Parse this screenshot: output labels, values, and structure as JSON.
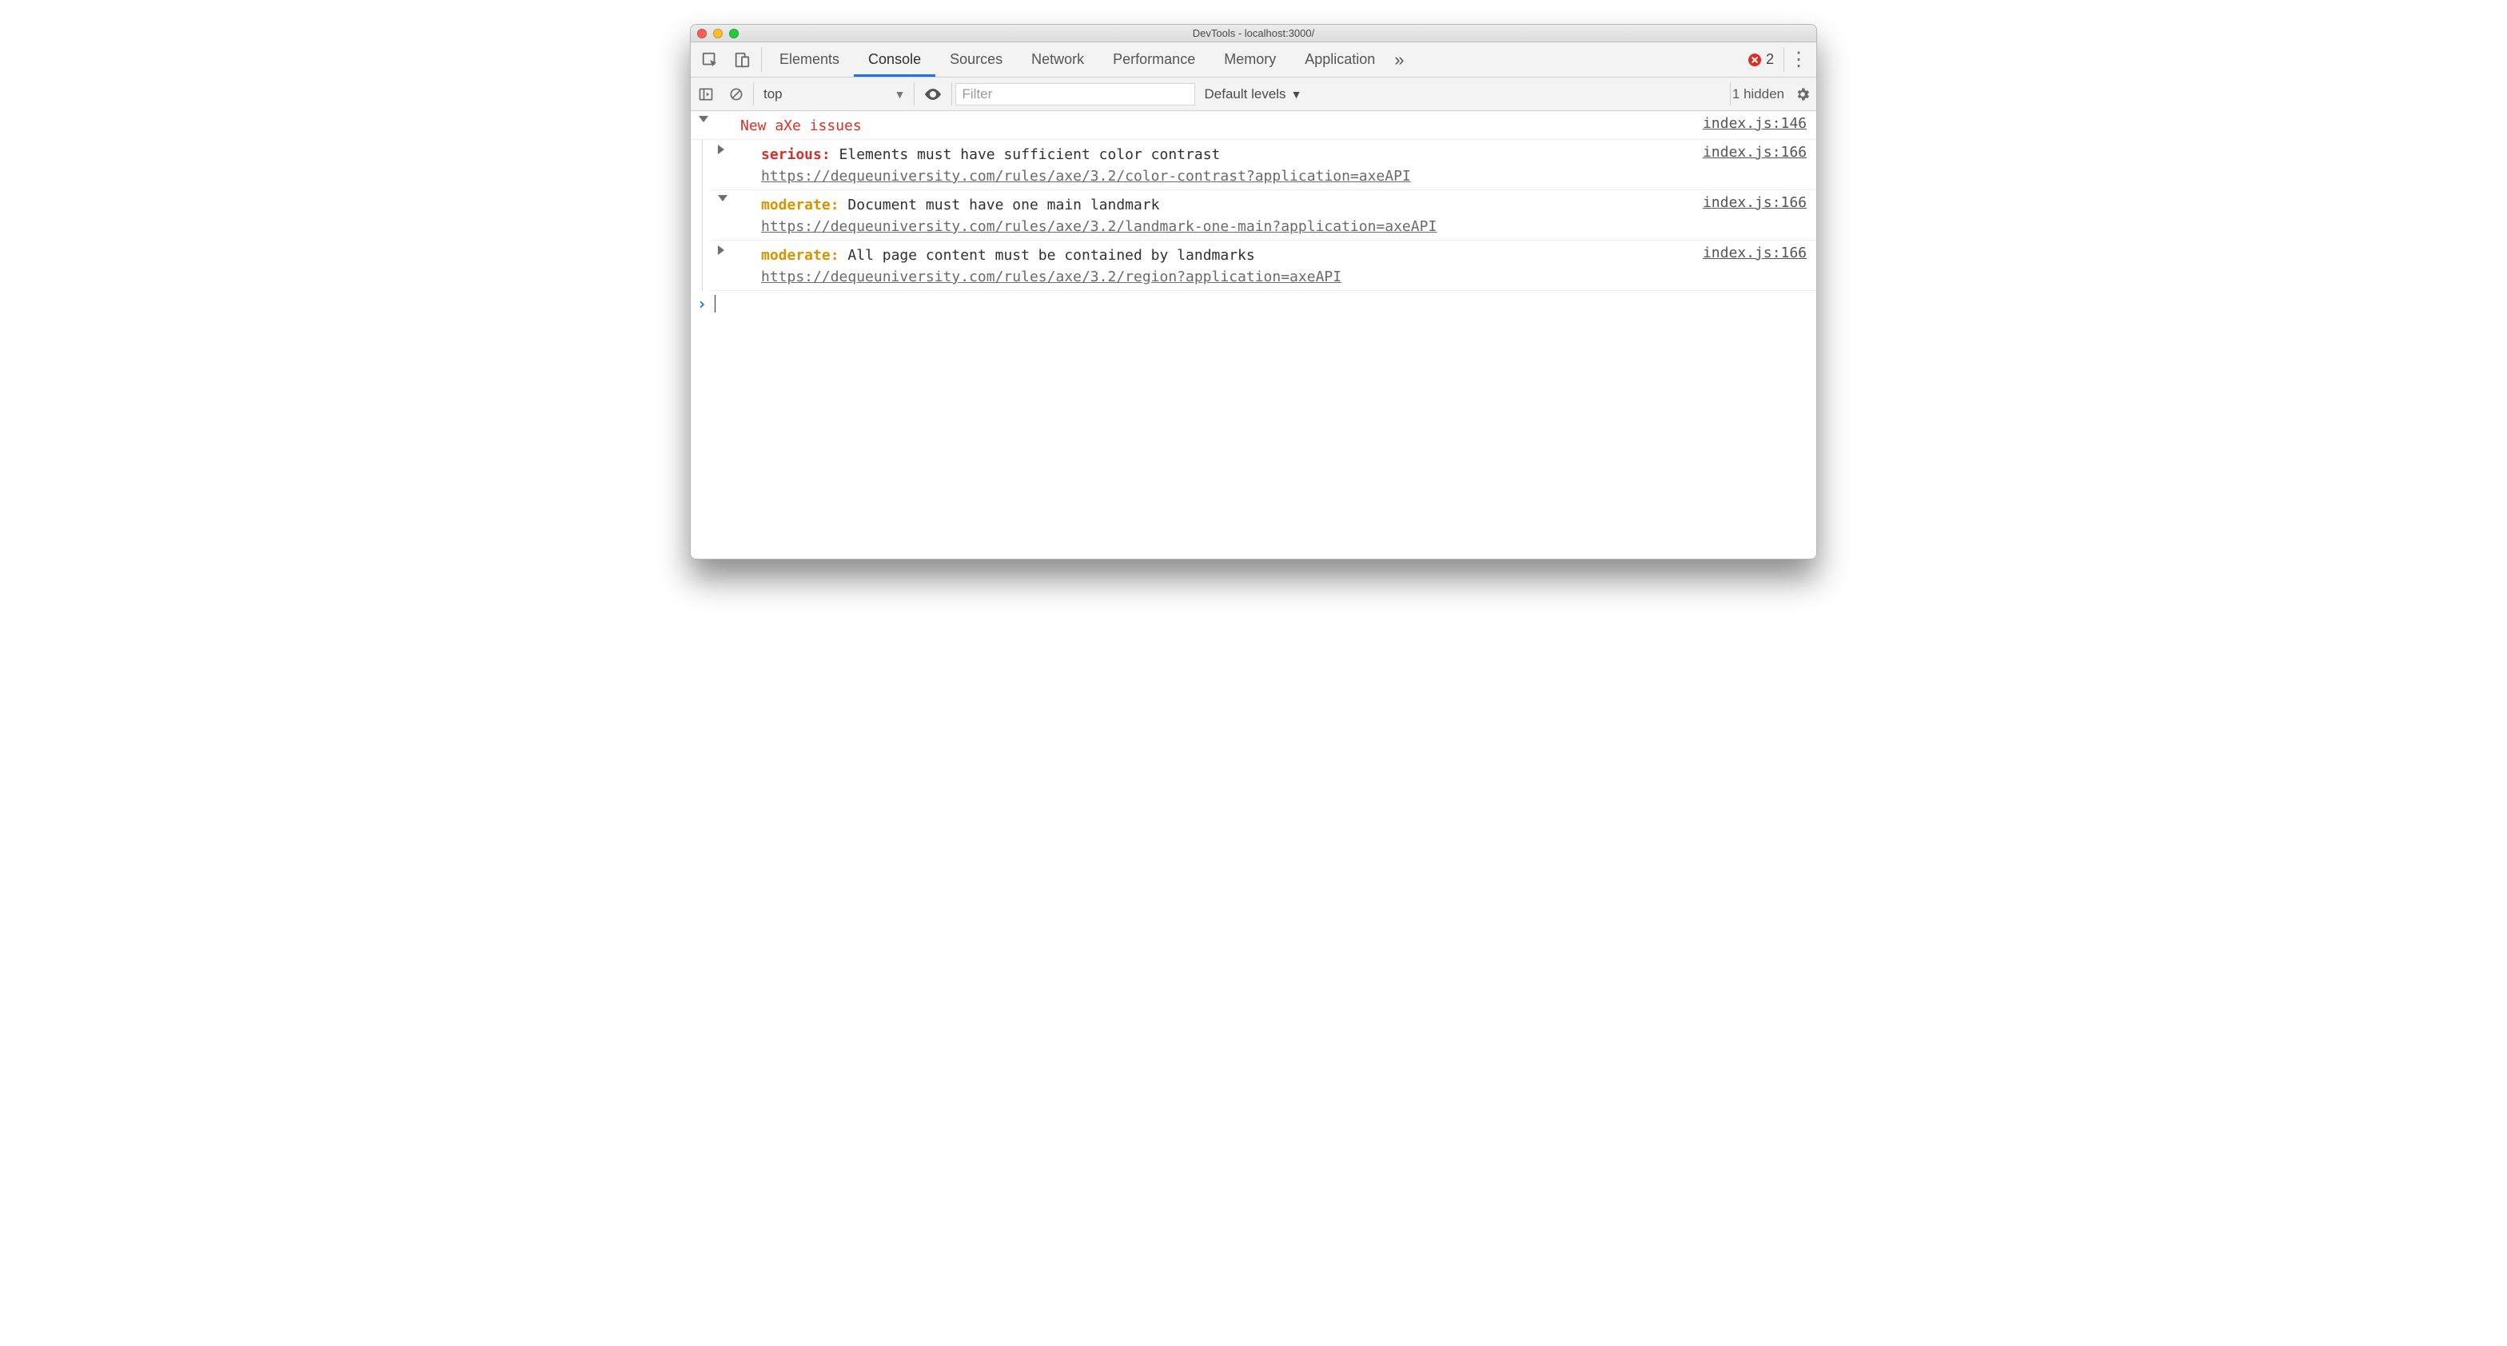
{
  "window": {
    "title": "DevTools - localhost:3000/"
  },
  "tabs": {
    "items": [
      "Elements",
      "Console",
      "Sources",
      "Network",
      "Performance",
      "Memory",
      "Application"
    ],
    "selected_index": 1,
    "error_count": "2"
  },
  "toolbar": {
    "context": "top",
    "filter_placeholder": "Filter",
    "levels_label": "Default levels",
    "hidden_label": "1 hidden"
  },
  "console": {
    "group": {
      "label": "New aXe issues",
      "source": "index.js:146"
    },
    "issues": [
      {
        "expanded": false,
        "severity_label": "serious:",
        "severity": "serious",
        "message": "Elements must have sufficient color contrast",
        "url": "https://dequeuniversity.com/rules/axe/3.2/color-contrast?application=axeAPI",
        "source": "index.js:166"
      },
      {
        "expanded": true,
        "severity_label": "moderate:",
        "severity": "moderate",
        "message": "Document must have one main landmark",
        "url": "https://dequeuniversity.com/rules/axe/3.2/landmark-one-main?application=axeAPI",
        "source": "index.js:166"
      },
      {
        "expanded": false,
        "severity_label": "moderate:",
        "severity": "moderate",
        "message": "All page content must be contained by landmarks",
        "url": "https://dequeuniversity.com/rules/axe/3.2/region?application=axeAPI",
        "source": "index.js:166"
      }
    ]
  }
}
